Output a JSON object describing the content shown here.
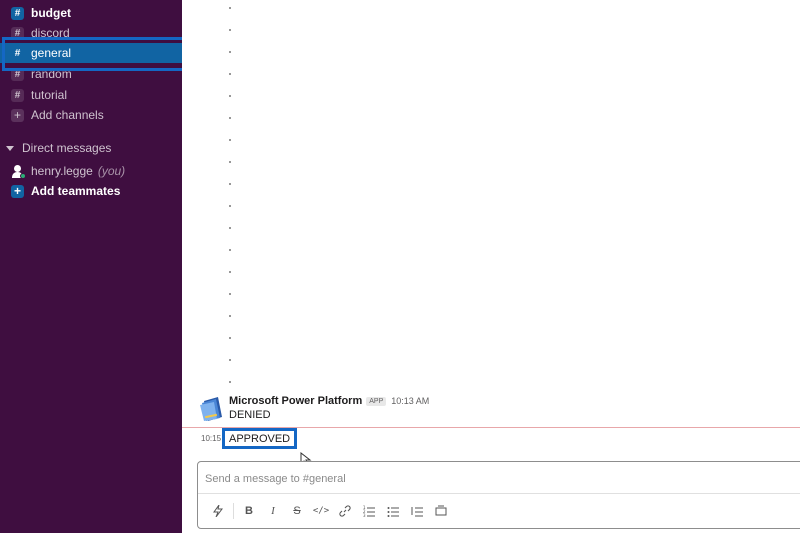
{
  "sidebar": {
    "channels": [
      {
        "label": "budget",
        "icon": "#",
        "state": "unread"
      },
      {
        "label": "discord",
        "icon": "#",
        "state": "normal"
      },
      {
        "label": "general",
        "icon": "#",
        "state": "active"
      },
      {
        "label": "random",
        "icon": "#",
        "state": "normal"
      },
      {
        "label": "tutorial",
        "icon": "#",
        "state": "normal"
      }
    ],
    "add_channels": "Add channels",
    "direct_messages_label": "Direct messages",
    "dm_user": "henry.legge",
    "dm_you": "(you)",
    "add_teammates": "Add teammates"
  },
  "messages": {
    "sender": "Microsoft Power Platform",
    "badge": "APP",
    "time": "10:13 AM",
    "text1": "DENIED",
    "short_time": "10:15",
    "text2": "APPROVED"
  },
  "composer": {
    "placeholder": "Send a message to #general"
  },
  "colors": {
    "sidebar_bg": "#3f0e40",
    "active_bg": "#1164a3",
    "highlight_border": "#1467c4",
    "new_divider": "#e8a7aa"
  }
}
